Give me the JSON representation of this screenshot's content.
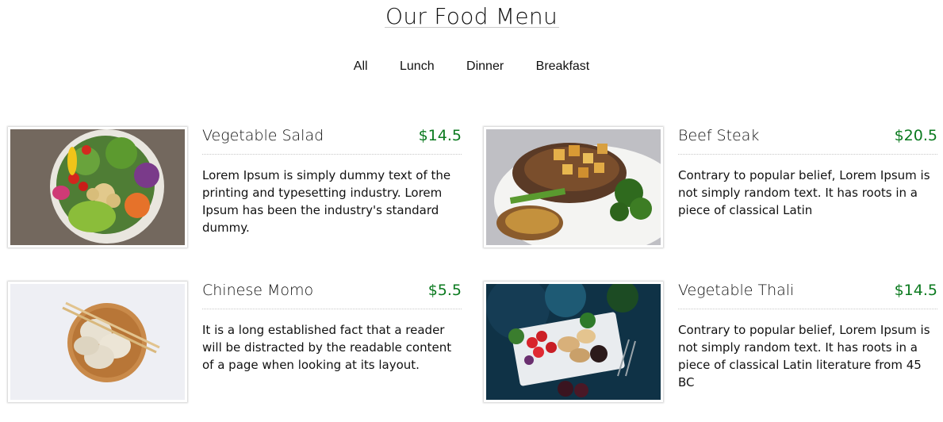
{
  "header": {
    "title": "Our Food Menu"
  },
  "filters": [
    "All",
    "Lunch",
    "Dinner",
    "Breakfast"
  ],
  "colors": {
    "price": "#0b7a1f",
    "text": "#111111",
    "rule": "#c8c8c8"
  },
  "items": [
    {
      "name": "Vegetable Salad",
      "price": "$14.5",
      "description": "Lorem Ipsum is simply dummy text of the printing and typesetting industry. Lorem Ipsum has been the industry's standard dummy."
    },
    {
      "name": "Beef Steak",
      "price": "$20.5",
      "description": "Contrary to popular belief, Lorem Ipsum is not simply random text. It has roots in a piece of classical Latin"
    },
    {
      "name": "Chinese Momo",
      "price": "$5.5",
      "description": "It is a long established fact that a reader will be distracted by the readable content of a page when looking at its layout."
    },
    {
      "name": "Vegetable Thali",
      "price": "$14.5",
      "description": "Contrary to popular belief, Lorem Ipsum is not simply random text. It has roots in a piece of classical Latin literature from 45 BC"
    }
  ]
}
